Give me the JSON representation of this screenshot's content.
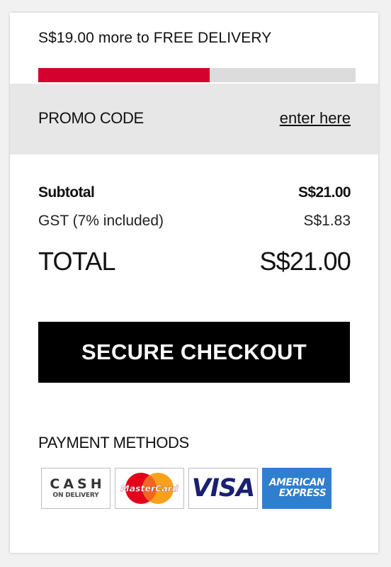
{
  "delivery": {
    "message": "S$19.00 more to FREE DELIVERY",
    "progress": 0.54,
    "progress_color": "#d4002e"
  },
  "promo": {
    "label": "PROMO CODE",
    "link": "enter here"
  },
  "summary": {
    "subtotal_label": "Subtotal",
    "subtotal_value": "S$21.00",
    "gst_label": "GST (7% included)",
    "gst_value": "S$1.83",
    "total_label": "TOTAL",
    "total_value": "S$21.00"
  },
  "checkout": {
    "label": "SECURE CHECKOUT"
  },
  "payment": {
    "title": "PAYMENT METHODS",
    "methods": [
      {
        "icon": "cash-on-delivery-icon",
        "line1": "CASH",
        "line2": "ON DELIVERY"
      },
      {
        "icon": "mastercard-icon",
        "text": "MasterCard"
      },
      {
        "icon": "visa-icon",
        "text": "VISA"
      },
      {
        "icon": "american-express-icon",
        "line1": "AMERICAN",
        "line2": "EXPRESS"
      }
    ]
  }
}
